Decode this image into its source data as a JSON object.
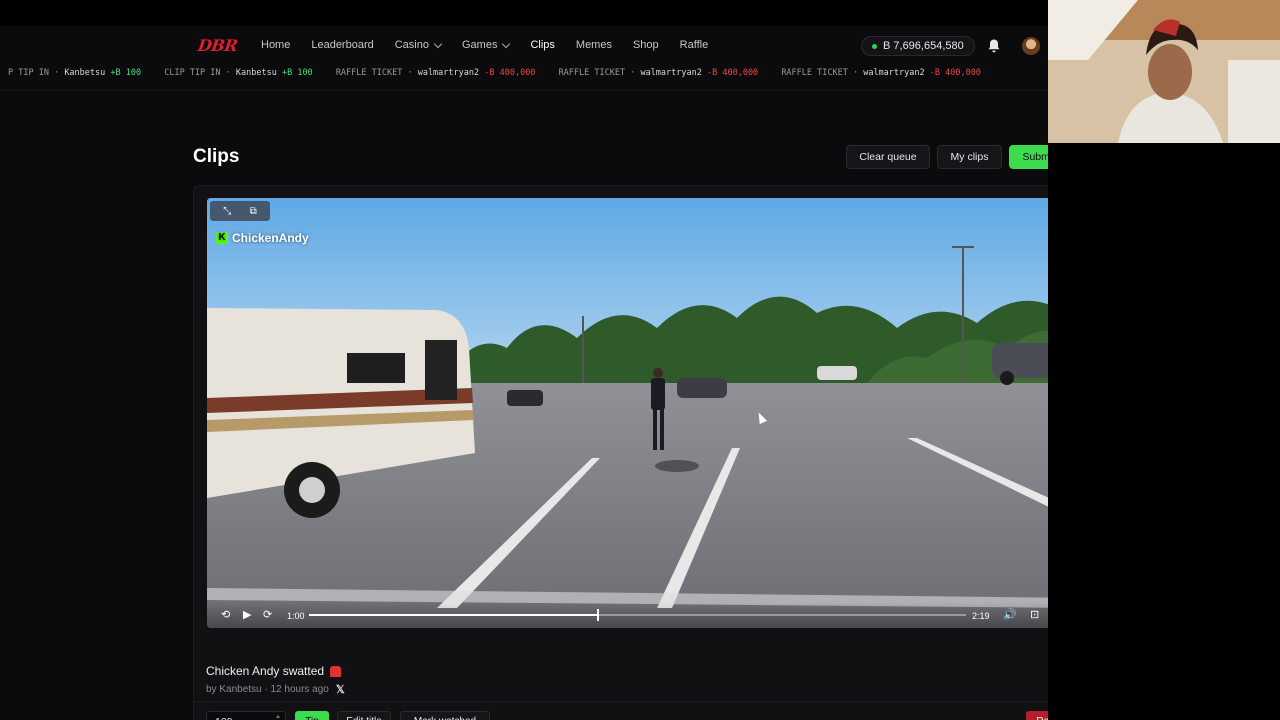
{
  "nav": {
    "logo": "DBR",
    "links": [
      {
        "label": "Home"
      },
      {
        "label": "Leaderboard"
      },
      {
        "label": "Casino"
      },
      {
        "label": "Games"
      },
      {
        "label": "Clips"
      },
      {
        "label": "Memes"
      },
      {
        "label": "Shop"
      },
      {
        "label": "Raffle"
      }
    ],
    "balance": "B 7,696,654,580"
  },
  "ticker": [
    {
      "type": "P TIP IN",
      "user": "Kanbetsu",
      "amount": "+B 100",
      "dir": "pos"
    },
    {
      "type": "CLIP TIP IN",
      "user": "Kanbetsu",
      "amount": "+B 100",
      "dir": "pos"
    },
    {
      "type": "RAFFLE TICKET",
      "user": "walmartryan2",
      "amount": "-B 400,000",
      "dir": "neg"
    },
    {
      "type": "RAFFLE TICKET",
      "user": "walmartryan2",
      "amount": "-B 400,000",
      "dir": "neg"
    },
    {
      "type": "RAFFLE TICKET",
      "user": "walmartryan2",
      "amount": "-B 400,000",
      "dir": "neg"
    }
  ],
  "page": {
    "title": "Clips",
    "clear_queue": "Clear queue",
    "my_clips": "My clips",
    "submit_clip": "Submit a clip"
  },
  "video": {
    "watermark": "ChickenAndy",
    "current_time": "1:00",
    "duration": "2:19",
    "progress": 0.44
  },
  "clip": {
    "title": "Chicken Andy swatted",
    "meta": "by Kanbetsu · 12 hours ago",
    "x_label": "𝕏",
    "tip_value": "100",
    "tip_button": "Tip",
    "edit_title": "Edit title",
    "mark_watched": "Mark watched",
    "remove": "Remove"
  },
  "colors": {
    "accent_green": "#3ddc4f",
    "danger_red": "#b3202b",
    "logo_red": "#e11d2e"
  }
}
